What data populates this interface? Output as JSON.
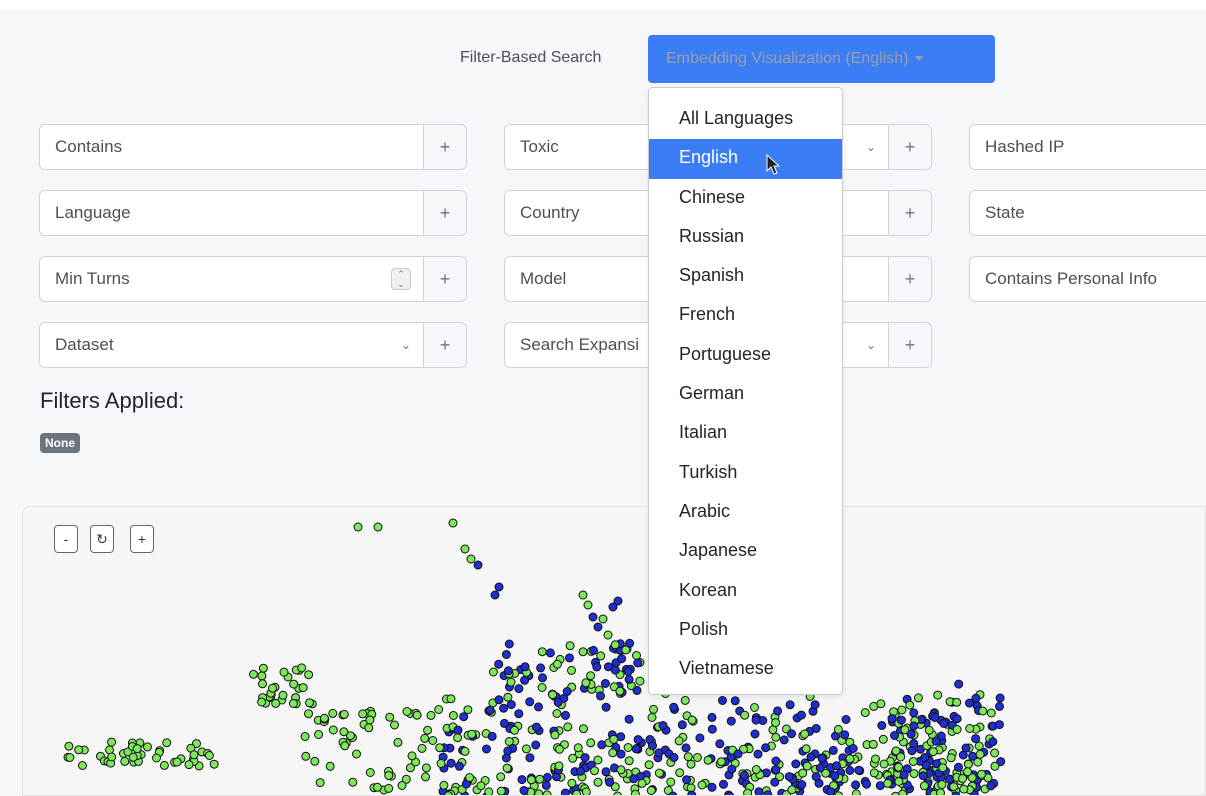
{
  "nav": {
    "filter_link": "Filter-Based Search",
    "dropdown_label": "Embedding Visualization (English)"
  },
  "filters": {
    "contains": "Contains",
    "toxic": "Toxic",
    "hashed_ip": "Hashed IP",
    "language": "Language",
    "country": "Country",
    "state": "State",
    "min_turns": "Min Turns",
    "model": "Model",
    "contains_personal_info": "Contains Personal Info",
    "dataset": "Dataset",
    "search_expansion": "Search Expansi",
    "plus": "+"
  },
  "applied": {
    "title": "Filters Applied:",
    "badge": "None"
  },
  "plot": {
    "zoom_out": "-",
    "zoom_in": "+",
    "colors": {
      "english": "#1f2fd1",
      "other": "#7ee85a"
    }
  },
  "menu": {
    "items": [
      "All Languages",
      "English",
      "Chinese",
      "Russian",
      "Spanish",
      "French",
      "Portuguese",
      "German",
      "Italian",
      "Turkish",
      "Arabic",
      "Japanese",
      "Korean",
      "Polish",
      "Vietnamese"
    ],
    "selected": "English"
  }
}
